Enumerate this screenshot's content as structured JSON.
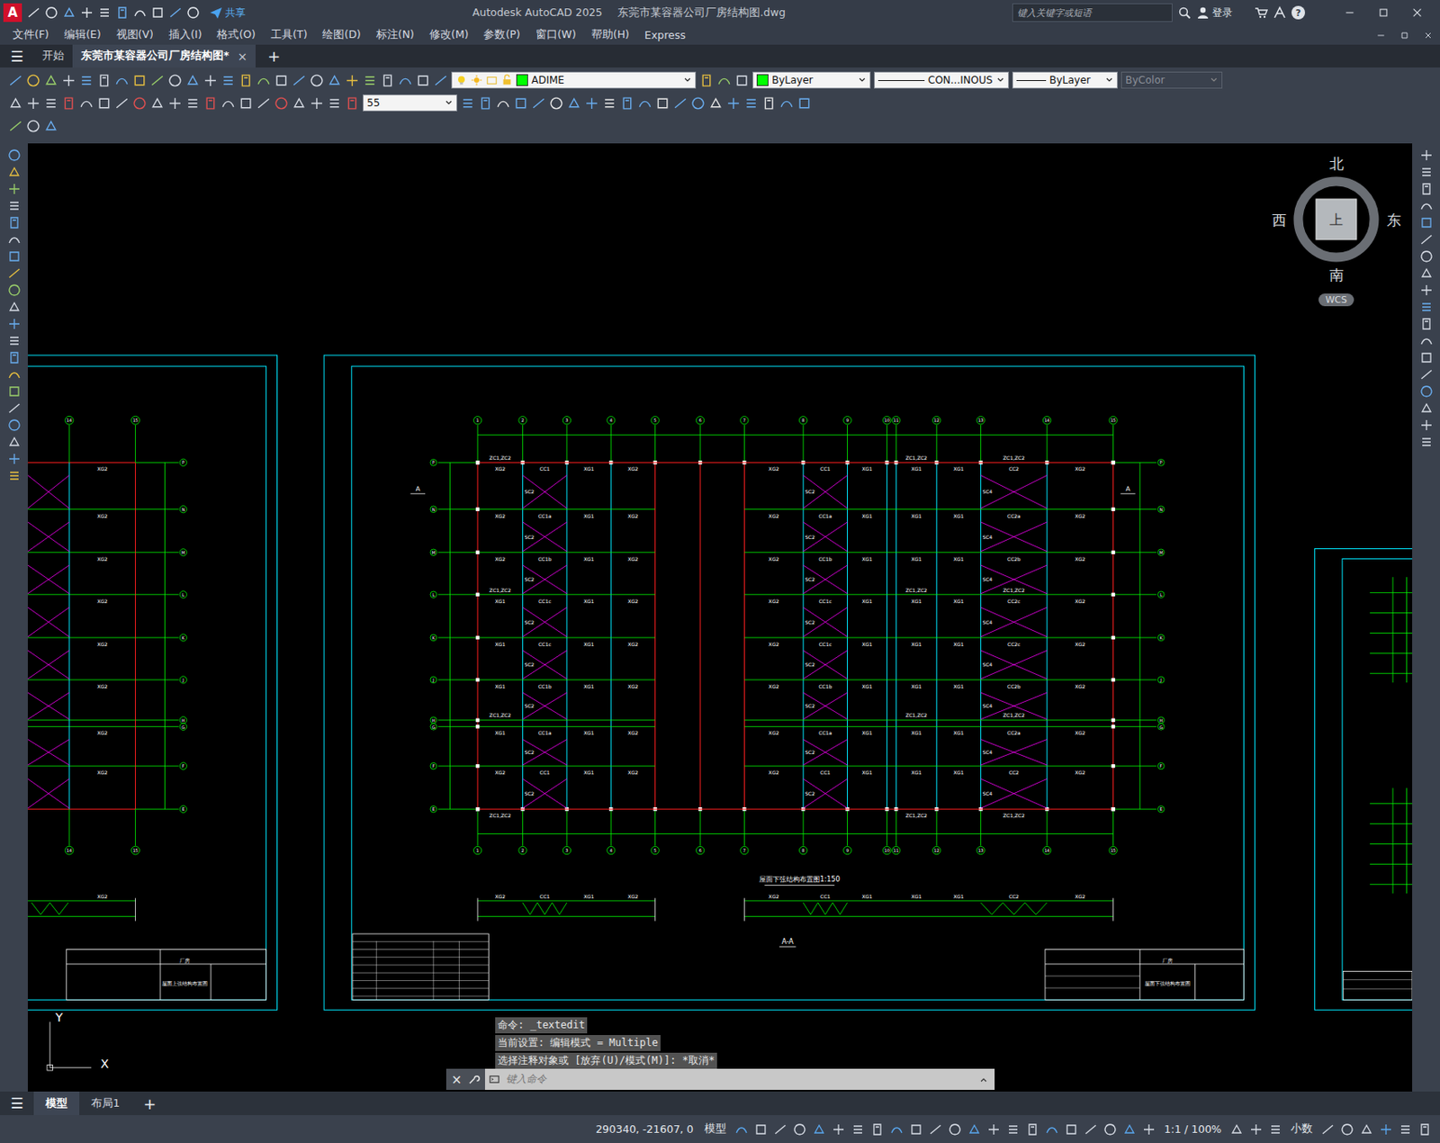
{
  "window": {
    "logo": "A",
    "app": "Autodesk AutoCAD 2025",
    "file": "东莞市某容器公司厂房结构图.dwg",
    "share": "共享",
    "search_placeholder": "键入关键字或短语",
    "login": "登录",
    "help": "?"
  },
  "menu": [
    "文件(F)",
    "编辑(E)",
    "视图(V)",
    "插入(I)",
    "格式(O)",
    "工具(T)",
    "绘图(D)",
    "标注(N)",
    "修改(M)",
    "参数(P)",
    "窗口(W)",
    "帮助(H)",
    "Express"
  ],
  "file_tabs": {
    "menu": "☰",
    "tabs": [
      {
        "label": "开始",
        "selected": false,
        "closable": false
      },
      {
        "label": "东莞市某容器公司厂房结构图*",
        "selected": true,
        "closable": true
      }
    ],
    "close": "×",
    "add": "+"
  },
  "properties": {
    "layer": "ADIME",
    "color": "ByLayer",
    "linetype": "CON...INOUS",
    "lineweight": "ByLayer",
    "plotstyle": {
      "label": "ByColor",
      "disabled": true
    },
    "dimscale": "55"
  },
  "viewcube": {
    "north": "北",
    "south": "南",
    "east": "东",
    "west": "西",
    "face": "上",
    "ucs": "WCS"
  },
  "ucs_icon": {
    "x": "X",
    "y": "Y"
  },
  "command": {
    "history": [
      "命令: _textedit",
      "当前设置: 编辑模式 = Multiple",
      "选择注释对象或 [放弃(U)/模式(M)]: *取消*"
    ],
    "placeholder": "键入命令",
    "close": "×"
  },
  "layout_tabs": {
    "menu": "☰",
    "tabs": [
      {
        "label": "模型",
        "selected": true
      },
      {
        "label": "布局1",
        "selected": false
      }
    ],
    "add": "+"
  },
  "status": {
    "coords": "290340, -21607, 0",
    "space": "模型",
    "scale": "1:1 / 100%",
    "units": "小数"
  },
  "drawing": {
    "main": {
      "columns": [
        "1",
        "2",
        "3",
        "4",
        "5",
        "6",
        "7",
        "8",
        "9",
        "10",
        "11",
        "12",
        "13",
        "14",
        "15"
      ],
      "rows": [
        "P",
        "N",
        "M",
        "L",
        "K",
        "J",
        "H",
        "G",
        "F",
        "E"
      ],
      "beam_rows": [
        [
          "XG2",
          "CC1",
          "XG1",
          "XG2",
          "",
          "",
          "XG2",
          "CC1",
          "XG1",
          "",
          "XG1",
          "XG1",
          "CC2",
          "XG2"
        ],
        [
          "XG2",
          "CC1a",
          "XG1",
          "XG2",
          "",
          "",
          "XG2",
          "CC1a",
          "XG1",
          "",
          "XG1",
          "XG1",
          "CC2a",
          "XG2"
        ],
        [
          "XG2",
          "CC1b",
          "XG1",
          "XG2",
          "",
          "",
          "XG2",
          "CC1b",
          "XG1",
          "",
          "XG1",
          "XG1",
          "CC2b",
          "XG2"
        ],
        [
          "XG1",
          "CC1c",
          "XG1",
          "XG2",
          "",
          "",
          "XG2",
          "CC1c",
          "XG1",
          "",
          "XG1",
          "XG1",
          "CC2c",
          "XG2"
        ],
        [
          "XG1",
          "CC1c",
          "XG1",
          "XG2",
          "",
          "",
          "XG2",
          "CC1c",
          "XG1",
          "",
          "XG1",
          "XG1",
          "CC2c",
          "XG2"
        ],
        [
          "XG1",
          "CC1b",
          "XG1",
          "XG2",
          "",
          "",
          "XG2",
          "CC1b",
          "XG1",
          "",
          "XG1",
          "XG1",
          "CC2b",
          "XG2"
        ],
        [
          "XG1",
          "CC1a",
          "XG1",
          "XG2",
          "",
          "",
          "XG2",
          "CC1a",
          "XG1",
          "",
          "XG1",
          "XG1",
          "CC2a",
          "XG2"
        ],
        [
          "XG2",
          "CC1",
          "XG1",
          "XG2",
          "",
          "",
          "XG2",
          "CC1",
          "XG1",
          "",
          "XG1",
          "XG1",
          "CC2",
          "XG2"
        ]
      ],
      "braces": [
        {
          "bay": 1,
          "label": "SC2"
        },
        {
          "bay": 7,
          "label": "SC2"
        },
        {
          "bay": 12,
          "label": "SC4"
        }
      ],
      "corner_label": "ZC1,ZC2",
      "section_labels": [
        "XG2",
        "CC1",
        "XG1",
        "XG2",
        "XG2",
        "CC1",
        "XG1",
        "XG1",
        "XG1",
        "CC2",
        "XG2"
      ],
      "title": "屋面下弦结构布置图1:150",
      "section_title": "A-A",
      "section_mark": "A",
      "sheet_name": "屋面下弦结构布置图",
      "project": "厂房"
    },
    "left": {
      "columns": [
        "14",
        "15"
      ],
      "rows": [
        "P",
        "N",
        "M",
        "L",
        "K",
        "J",
        "H",
        "G",
        "F",
        "E"
      ],
      "beam_labels": [
        "XG2",
        "XG2",
        "XG2",
        "XG2",
        "XG2",
        "XG2",
        "XG2",
        "XG2"
      ],
      "sheet_name": "屋面上弦结构布置图",
      "project": "厂房"
    }
  }
}
